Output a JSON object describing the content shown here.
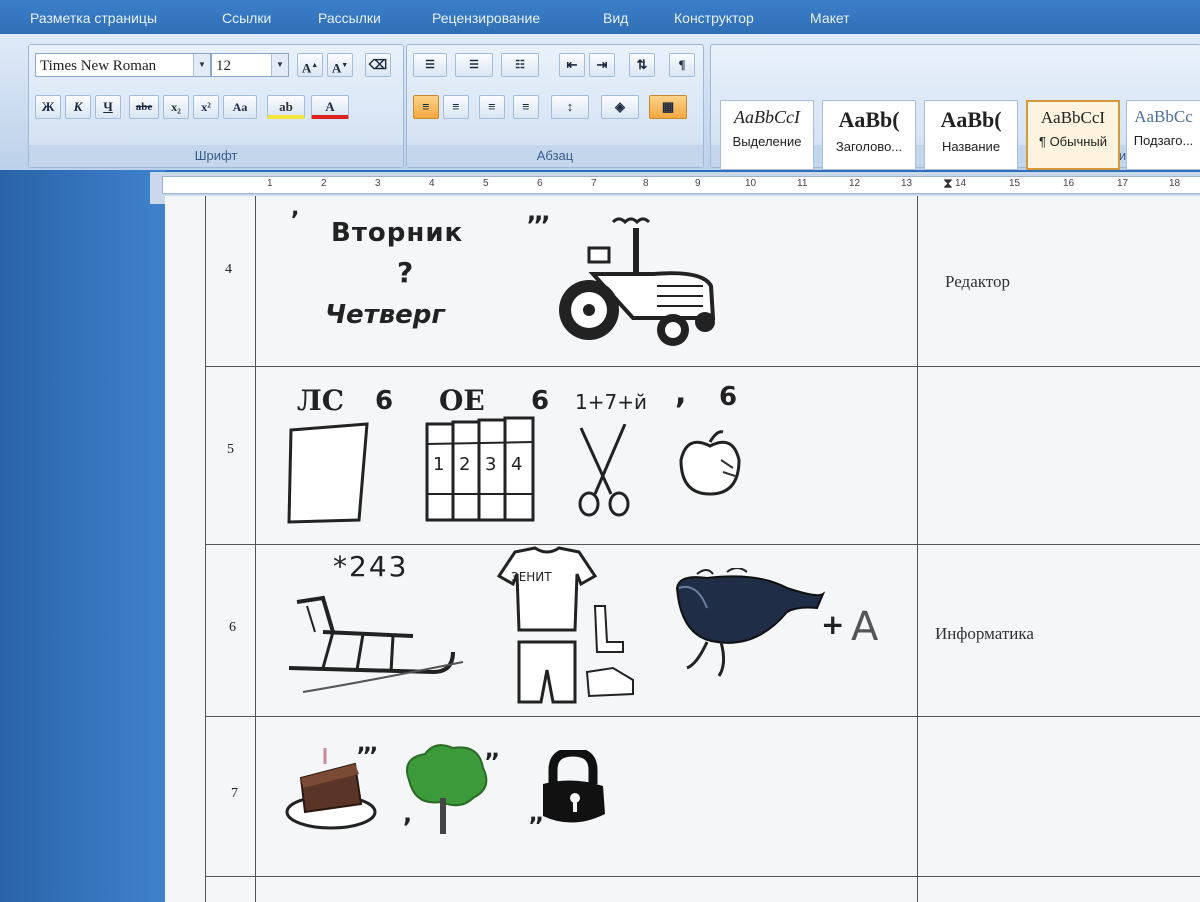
{
  "tabs": [
    "Разметка страницы",
    "Ссылки",
    "Рассылки",
    "Рецензирование",
    "Вид",
    "Конструктор",
    "Макет"
  ],
  "font": {
    "name": "Times New Roman",
    "size": "12",
    "group_label": "Шрифт"
  },
  "font_buttons": [
    "Ж",
    "К",
    "Ч",
    "abe",
    "x₂",
    "x²",
    "Aa"
  ],
  "paragraph": {
    "group_label": "Абзац"
  },
  "styles": {
    "items": [
      {
        "sample": "AaBbCcI",
        "name": "Выделение"
      },
      {
        "sample": "AaBb(",
        "name": "Заголово..."
      },
      {
        "sample": "AaBb(",
        "name": "Название"
      },
      {
        "sample": "AaBbCcI",
        "name": "¶ Обычный"
      },
      {
        "sample": "AaBbCc",
        "name": "Подзаго..."
      }
    ],
    "group_label": "Стили"
  },
  "ruler": {
    "numbers": [
      "1",
      "2",
      "3",
      "4",
      "5",
      "6",
      "7",
      "8",
      "9",
      "10",
      "11",
      "12",
      "13",
      "14",
      "15",
      "16",
      "17",
      "18"
    ]
  },
  "rows": [
    {
      "num": "4",
      "answer": "Редактор"
    },
    {
      "num": "5",
      "answer": ""
    },
    {
      "num": "6",
      "answer": "Информатика"
    },
    {
      "num": "7",
      "answer": ""
    }
  ],
  "rebus": {
    "r4": {
      "word1": "Вторник",
      "q": "?",
      "word2": "Четверг",
      "comma1": ",",
      "commas2": ",,,"
    },
    "r5": {
      "t1": "ЛС",
      "c1": "6",
      "t2": "ОЕ",
      "c2": "6",
      "t3": "1+7+й",
      "t4": ",",
      "c4": "6",
      "books": [
        "1",
        "2",
        "3",
        "4"
      ]
    },
    "r6": {
      "digits": "*243",
      "shirt": "ЗЕНИТ",
      "plus": "+",
      "letter": "A"
    },
    "r7": {
      "c1": ",,,",
      "c2": ",,",
      "c3": ",",
      "c4": ",,"
    }
  }
}
